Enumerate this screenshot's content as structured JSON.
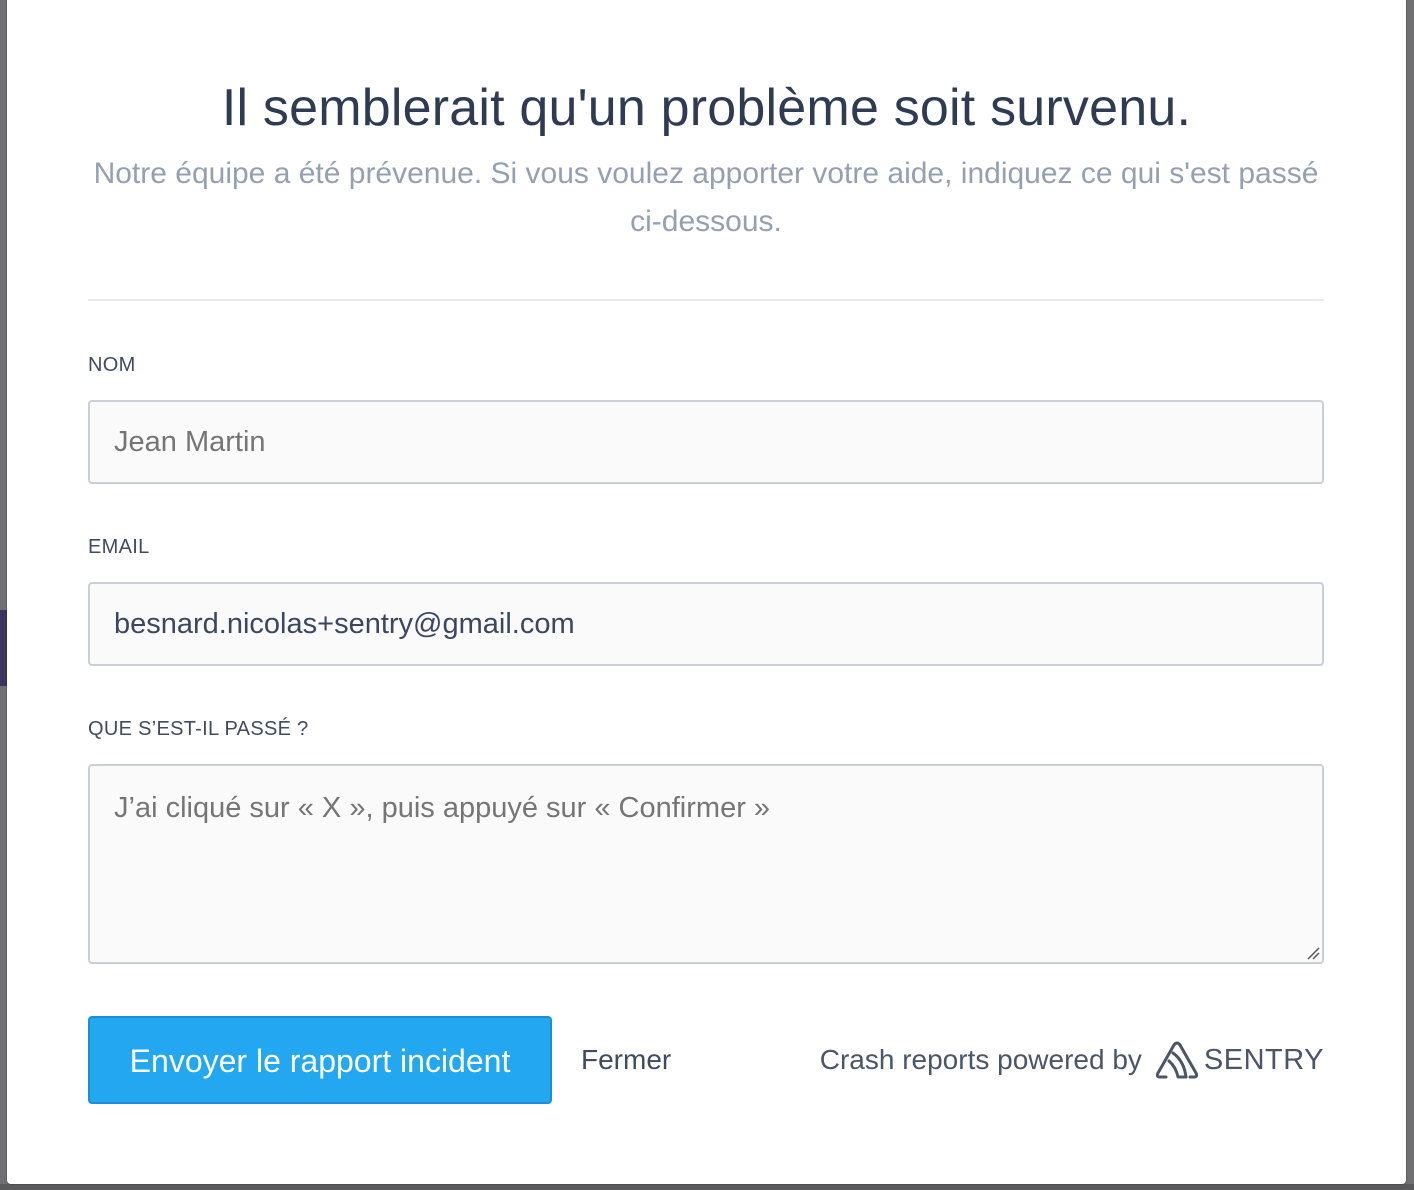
{
  "dialog": {
    "title": "Il semblerait qu'un problème soit survenu.",
    "subtitle": "Notre équipe a été prévenue. Si vous voulez apporter votre aide, indiquez ce qui s'est passé ci-dessous."
  },
  "form": {
    "name": {
      "label": "NOM",
      "placeholder": "Jean Martin",
      "value": ""
    },
    "email": {
      "label": "EMAIL",
      "placeholder": "",
      "value": "besnard.nicolas+sentry@gmail.com"
    },
    "comments": {
      "label": "QUE S’EST-IL PASSÉ ?",
      "placeholder": "J’ai cliqué sur « X », puis appuyé sur « Confirmer »",
      "value": ""
    }
  },
  "actions": {
    "submit_label": "Envoyer le rapport incident",
    "close_label": "Fermer"
  },
  "footer": {
    "powered_by": "Crash reports powered by",
    "brand": "SENTRY",
    "brand_icon": "sentry-logo-icon"
  },
  "colors": {
    "title": "#2f3b52",
    "subtitle": "#94a0b1",
    "submit_button": "#22a7f0",
    "field_border": "#c9cfd8",
    "field_background": "#fafafa"
  }
}
